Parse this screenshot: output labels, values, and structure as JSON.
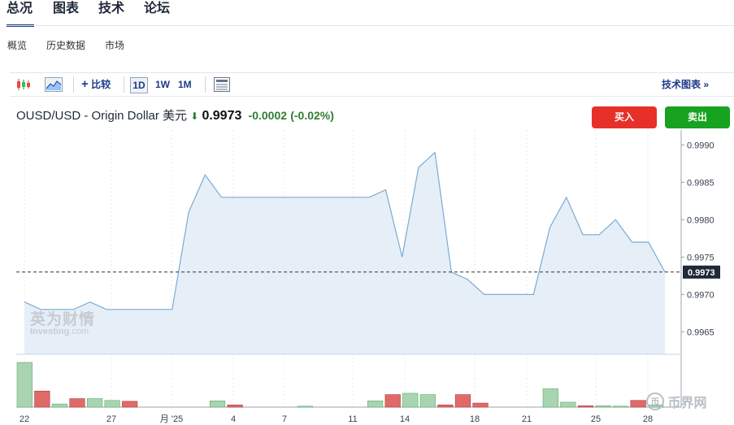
{
  "tabs": {
    "overview": "总况",
    "charts": "图表",
    "technical": "技术",
    "forum": "论坛"
  },
  "subtabs": {
    "overview": "概览",
    "history": "历史数据",
    "markets": "市场"
  },
  "toolbar": {
    "compare": "比较",
    "d1": "1D",
    "w1": "1W",
    "m1": "1M",
    "tech_chart": "技术图表 »"
  },
  "quote": {
    "symbol": "OUSD/USD - Origin Dollar 美元",
    "arrow": "⬇",
    "price": "0.9973",
    "change": "-0.0002",
    "pct": "(-0.02%)"
  },
  "actions": {
    "buy": "买入",
    "sell": "卖出"
  },
  "colors": {
    "accent": "#1e3a8a",
    "buy": "#e8302a",
    "sell": "#17a21f",
    "down": "#2e7d32",
    "line": "#7aaad4",
    "area": "#e3edf7",
    "vol_up": "#a8d5b0",
    "vol_down": "#e06a6a"
  },
  "watermark": {
    "cn": "英为财情",
    "en": "Investing",
    "dotcom": ".com"
  },
  "corner_logo": "币界网",
  "chart_data": {
    "type": "area",
    "x_labels": [
      "22",
      "27",
      "月 '25",
      "4",
      "7",
      "11",
      "14",
      "18",
      "21",
      "25",
      "28"
    ],
    "y_ticks": [
      "0.9990",
      "0.9985",
      "0.9980",
      "0.9975",
      "0.9970",
      "0.9965"
    ],
    "ylim": [
      0.9962,
      0.9992
    ],
    "current_value": 0.9973,
    "current_label": "0.9973",
    "values": [
      0.9969,
      0.9968,
      0.9968,
      0.9968,
      0.9969,
      0.9968,
      0.9968,
      0.9968,
      0.9968,
      0.9968,
      0.9981,
      0.9986,
      0.9983,
      0.9983,
      0.9983,
      0.9983,
      0.9983,
      0.9983,
      0.9983,
      0.9983,
      0.9983,
      0.9983,
      0.9984,
      0.9975,
      0.9987,
      0.9989,
      0.9973,
      0.9972,
      0.997,
      0.997,
      0.997,
      0.997,
      0.9979,
      0.9983,
      0.9978,
      0.9978,
      0.998,
      0.9977,
      0.9977,
      0.9973
    ],
    "volume": [
      {
        "v": 1.0,
        "d": "up"
      },
      {
        "v": 0.36,
        "d": "down"
      },
      {
        "v": 0.07,
        "d": "up"
      },
      {
        "v": 0.19,
        "d": "down"
      },
      {
        "v": 0.19,
        "d": "up"
      },
      {
        "v": 0.15,
        "d": "up"
      },
      {
        "v": 0.13,
        "d": "down"
      },
      {
        "v": 0,
        "d": "up"
      },
      {
        "v": 0,
        "d": "up"
      },
      {
        "v": 0,
        "d": "up"
      },
      {
        "v": 0,
        "d": "up"
      },
      {
        "v": 0.14,
        "d": "up"
      },
      {
        "v": 0.05,
        "d": "down"
      },
      {
        "v": 0,
        "d": "up"
      },
      {
        "v": 0,
        "d": "up"
      },
      {
        "v": 0,
        "d": "up"
      },
      {
        "v": 0.02,
        "d": "up"
      },
      {
        "v": 0,
        "d": "up"
      },
      {
        "v": 0,
        "d": "up"
      },
      {
        "v": 0,
        "d": "up"
      },
      {
        "v": 0.14,
        "d": "up"
      },
      {
        "v": 0.28,
        "d": "down"
      },
      {
        "v": 0.31,
        "d": "up"
      },
      {
        "v": 0.28,
        "d": "up"
      },
      {
        "v": 0.05,
        "d": "down"
      },
      {
        "v": 0.28,
        "d": "down"
      },
      {
        "v": 0.09,
        "d": "down"
      },
      {
        "v": 0,
        "d": "up"
      },
      {
        "v": 0,
        "d": "up"
      },
      {
        "v": 0,
        "d": "up"
      },
      {
        "v": 0.41,
        "d": "up"
      },
      {
        "v": 0.11,
        "d": "up"
      },
      {
        "v": 0.03,
        "d": "down"
      },
      {
        "v": 0.03,
        "d": "up"
      },
      {
        "v": 0.02,
        "d": "up"
      },
      {
        "v": 0.15,
        "d": "down"
      },
      {
        "v": 0.05,
        "d": "up"
      }
    ],
    "grid": "vertical-dashed"
  }
}
